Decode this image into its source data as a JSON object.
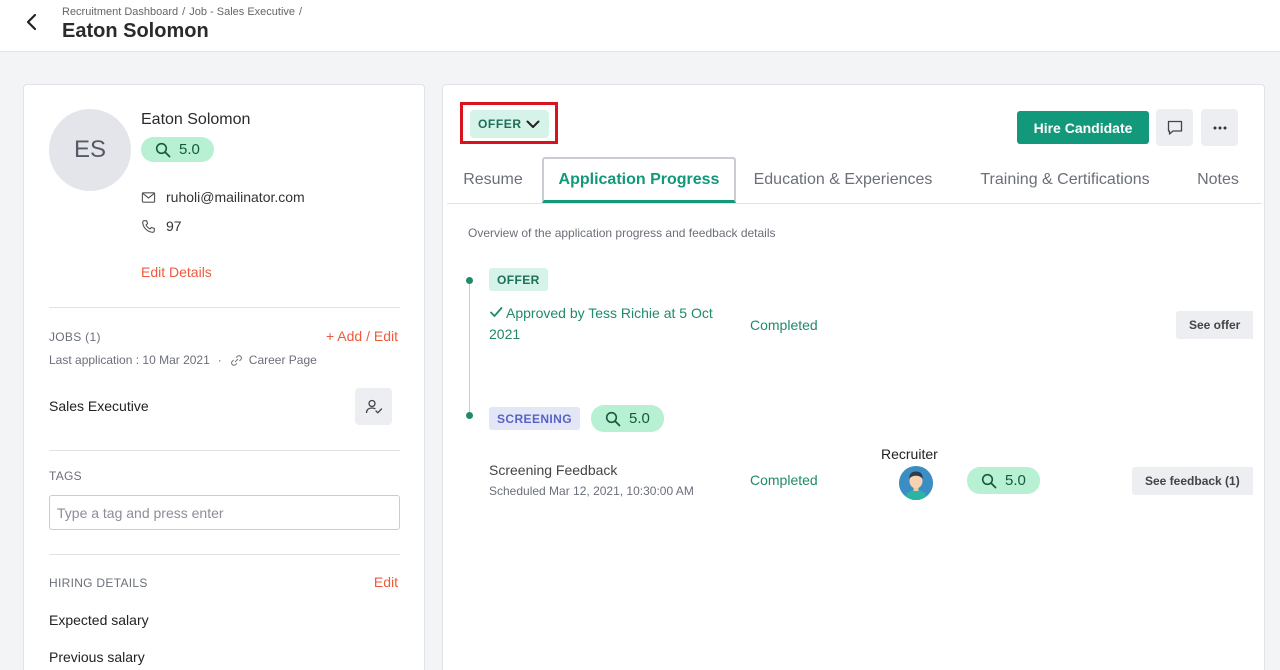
{
  "header": {
    "breadcrumb": [
      "Recruitment Dashboard",
      "/",
      "Job - Sales Executive",
      "/"
    ],
    "title": "Eaton Solomon"
  },
  "candidate": {
    "initials": "ES",
    "name": "Eaton Solomon",
    "score": "5.0",
    "email": "ruholi@mailinator.com",
    "phone": "97",
    "edit_details_label": "Edit Details"
  },
  "jobs": {
    "label": "JOBS (1)",
    "add_edit_label": "+ Add / Edit",
    "last_application": "Last application : 10 Mar 2021",
    "separator": "·",
    "source": "Career Page",
    "job_title": "Sales Executive"
  },
  "tags": {
    "label": "TAGS",
    "placeholder": "Type a tag and press enter"
  },
  "hiring": {
    "label": "HIRING DETAILS",
    "edit_label": "Edit",
    "rows": [
      "Expected salary",
      "Previous salary"
    ]
  },
  "status": {
    "current": "OFFER"
  },
  "actions": {
    "hire_label": "Hire Candidate",
    "comment_icon": "comment-icon",
    "more_icon": "more-icon"
  },
  "tabs": [
    {
      "label": "Resume",
      "active": false
    },
    {
      "label": "Application Progress",
      "active": true
    },
    {
      "label": "Education & Experiences",
      "active": false
    },
    {
      "label": "Training & Certifications",
      "active": false
    },
    {
      "label": "Notes",
      "active": false
    }
  ],
  "progress": {
    "overview": "Overview of the application progress and feedback details",
    "stages": [
      {
        "badge": "OFFER",
        "approved": "Approved by Tess Richie at 5 Oct 2021",
        "status": "Completed",
        "action": "See offer"
      },
      {
        "badge": "SCREENING",
        "score": "5.0",
        "feedback_title": "Screening Feedback",
        "scheduled": "Scheduled Mar 12, 2021, 10:30:00 AM",
        "status": "Completed",
        "recruiter_label": "Recruiter",
        "recruiter_score": "5.0",
        "action": "See feedback (1)"
      }
    ]
  },
  "colors": {
    "accent": "#12987a",
    "link_red": "#ef5a3c",
    "score_bg": "#b8f0d3",
    "highlight": "#d9131e"
  }
}
